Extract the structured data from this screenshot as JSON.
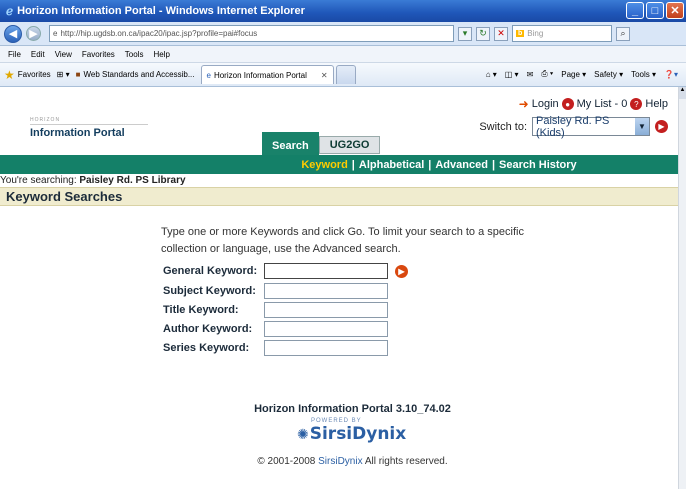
{
  "window": {
    "title": "Horizon Information Portal - Windows Internet Explorer",
    "url": "http://hip.ugdsb.on.ca/ipac20/ipac.jsp?profile=pai#focus",
    "url_domain": "ugdsb.on.ca",
    "search_engine": "Bing"
  },
  "menu": [
    "File",
    "Edit",
    "View",
    "Favorites",
    "Tools",
    "Help"
  ],
  "favbar": {
    "favorites_label": "Favorites",
    "fav_item": "Web Standards and Accessib...",
    "tab_label": "Horizon Information Portal",
    "commands": [
      "Page ▾",
      "Safety ▾",
      "Tools ▾"
    ]
  },
  "header": {
    "login": "Login",
    "mylist": "My List - 0",
    "help": "Help",
    "logo_small": "HORIZON",
    "logo_main": "Information Portal",
    "switch_label": "Switch to:",
    "switch_value": "Paisley Rd. PS (Kids)"
  },
  "tabs": [
    "Search",
    "UG2GO"
  ],
  "subnav": [
    "Keyword",
    "Alphabetical",
    "Advanced",
    "Search History"
  ],
  "searching": {
    "prefix": "You're searching:",
    "library": "Paisley Rd. PS Library"
  },
  "section_title": "Keyword Searches",
  "instructions": "Type one or more Keywords and click Go. To limit your search to a specific collection or language, use the Advanced search.",
  "fields": [
    {
      "label": "General Keyword:",
      "value": ""
    },
    {
      "label": "Subject Keyword:",
      "value": ""
    },
    {
      "label": "Title Keyword:",
      "value": ""
    },
    {
      "label": "Author Keyword:",
      "value": ""
    },
    {
      "label": "Series Keyword:",
      "value": ""
    }
  ],
  "footer": {
    "version": "Horizon Information Portal 3.10_74.02",
    "powered": "POWERED BY",
    "brand": "SirsiDynix",
    "copyright_prefix": "© 2001-2008",
    "copyright_suffix": "All rights reserved."
  }
}
